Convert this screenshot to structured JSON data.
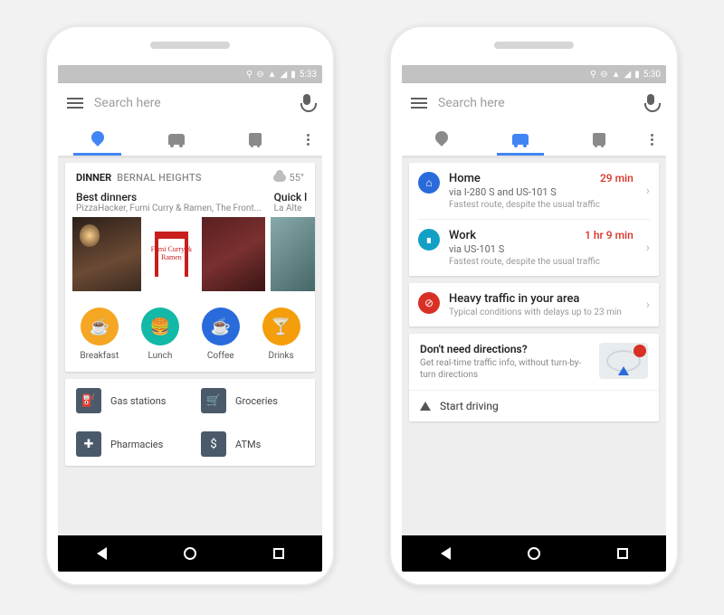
{
  "status": {
    "time_left": "5:33",
    "time_right": "5:30"
  },
  "search": {
    "placeholder": "Search here"
  },
  "tabs": {
    "explore": "Explore",
    "driving": "Driving",
    "transit": "Transit"
  },
  "left": {
    "header": {
      "title": "DINNER",
      "area": "BERNAL HEIGHTS",
      "temp": "55°"
    },
    "carousel": {
      "main": {
        "title": "Best dinners",
        "subtitle": "PizzaHacker, Fumi Curry & Ramen, The Front...",
        "fumi_label": "Fumi\nCurry\n&\nRamen"
      },
      "peek": {
        "title": "Quick l",
        "subtitle": "La Alte"
      }
    },
    "cats": [
      {
        "label": "Breakfast",
        "glyph": "☕",
        "colorClass": "c-orange"
      },
      {
        "label": "Lunch",
        "glyph": "🍔",
        "colorClass": "c-teal"
      },
      {
        "label": "Coffee",
        "glyph": "☕",
        "colorClass": "c-blue"
      },
      {
        "label": "Drinks",
        "glyph": "🍸",
        "colorClass": "c-amber"
      }
    ],
    "services": [
      {
        "label": "Gas stations",
        "glyph": "⛽"
      },
      {
        "label": "Groceries",
        "glyph": "🛒"
      },
      {
        "label": "Pharmacies",
        "glyph": "✚"
      },
      {
        "label": "ATMs",
        "glyph": "$"
      }
    ]
  },
  "right": {
    "dest": [
      {
        "name": "Home",
        "eta": "29 min",
        "via": "via I-280 S and US-101 S",
        "note": "Fastest route, despite the usual traffic",
        "iconClass": "i-home",
        "glyph": "⌂"
      },
      {
        "name": "Work",
        "eta": "1 hr 9 min",
        "via": "via US-101 S",
        "note": "Fastest route, despite the usual traffic",
        "iconClass": "i-work",
        "glyph": "∎"
      }
    ],
    "traffic": {
      "title": "Heavy traffic in your area",
      "sub": "Typical conditions with delays up to 23 min",
      "glyph": "⊘"
    },
    "promo": {
      "title": "Don't need directions?",
      "sub": "Get real-time traffic info, without turn-by-turn directions"
    },
    "start": {
      "label": "Start driving"
    }
  }
}
